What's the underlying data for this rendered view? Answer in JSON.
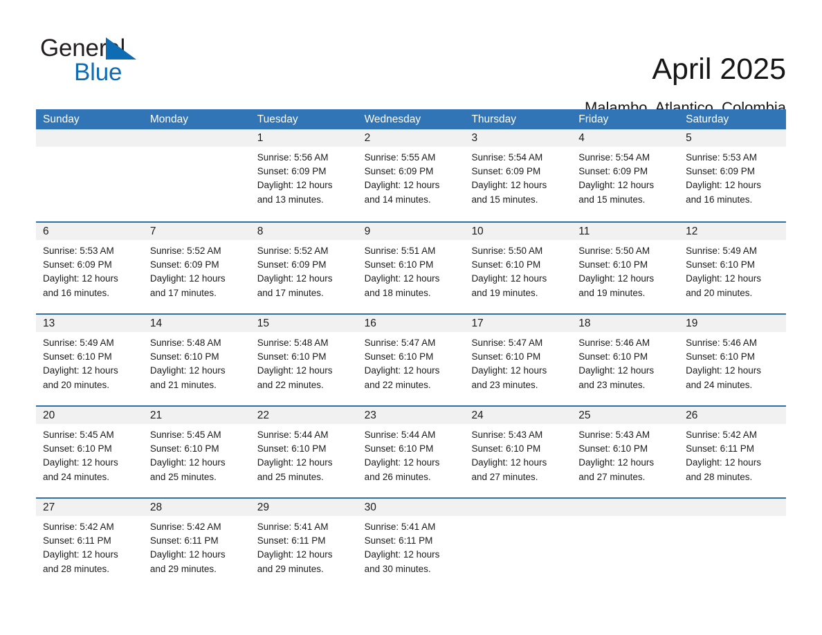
{
  "brand": {
    "name_part1": "General",
    "name_part2": "Blue",
    "triangle_color": "#0d6cb4",
    "text_color": "#231f20"
  },
  "header": {
    "title": "April 2025",
    "subtitle": "Malambo, Atlantico, Colombia"
  },
  "theme": {
    "header_blue": "#3175b7",
    "divider_blue": "#2f6fa8",
    "daynum_band": "#f1f1f1",
    "text": "#1a1a1a"
  },
  "weekdays": [
    "Sunday",
    "Monday",
    "Tuesday",
    "Wednesday",
    "Thursday",
    "Friday",
    "Saturday"
  ],
  "weeks": [
    [
      {
        "day": "",
        "lines": [
          "",
          "",
          "",
          ""
        ]
      },
      {
        "day": "",
        "lines": [
          "",
          "",
          "",
          ""
        ]
      },
      {
        "day": "1",
        "lines": [
          "Sunrise: 5:56 AM",
          "Sunset: 6:09 PM",
          "Daylight: 12 hours",
          "and 13 minutes."
        ]
      },
      {
        "day": "2",
        "lines": [
          "Sunrise: 5:55 AM",
          "Sunset: 6:09 PM",
          "Daylight: 12 hours",
          "and 14 minutes."
        ]
      },
      {
        "day": "3",
        "lines": [
          "Sunrise: 5:54 AM",
          "Sunset: 6:09 PM",
          "Daylight: 12 hours",
          "and 15 minutes."
        ]
      },
      {
        "day": "4",
        "lines": [
          "Sunrise: 5:54 AM",
          "Sunset: 6:09 PM",
          "Daylight: 12 hours",
          "and 15 minutes."
        ]
      },
      {
        "day": "5",
        "lines": [
          "Sunrise: 5:53 AM",
          "Sunset: 6:09 PM",
          "Daylight: 12 hours",
          "and 16 minutes."
        ]
      }
    ],
    [
      {
        "day": "6",
        "lines": [
          "Sunrise: 5:53 AM",
          "Sunset: 6:09 PM",
          "Daylight: 12 hours",
          "and 16 minutes."
        ]
      },
      {
        "day": "7",
        "lines": [
          "Sunrise: 5:52 AM",
          "Sunset: 6:09 PM",
          "Daylight: 12 hours",
          "and 17 minutes."
        ]
      },
      {
        "day": "8",
        "lines": [
          "Sunrise: 5:52 AM",
          "Sunset: 6:09 PM",
          "Daylight: 12 hours",
          "and 17 minutes."
        ]
      },
      {
        "day": "9",
        "lines": [
          "Sunrise: 5:51 AM",
          "Sunset: 6:10 PM",
          "Daylight: 12 hours",
          "and 18 minutes."
        ]
      },
      {
        "day": "10",
        "lines": [
          "Sunrise: 5:50 AM",
          "Sunset: 6:10 PM",
          "Daylight: 12 hours",
          "and 19 minutes."
        ]
      },
      {
        "day": "11",
        "lines": [
          "Sunrise: 5:50 AM",
          "Sunset: 6:10 PM",
          "Daylight: 12 hours",
          "and 19 minutes."
        ]
      },
      {
        "day": "12",
        "lines": [
          "Sunrise: 5:49 AM",
          "Sunset: 6:10 PM",
          "Daylight: 12 hours",
          "and 20 minutes."
        ]
      }
    ],
    [
      {
        "day": "13",
        "lines": [
          "Sunrise: 5:49 AM",
          "Sunset: 6:10 PM",
          "Daylight: 12 hours",
          "and 20 minutes."
        ]
      },
      {
        "day": "14",
        "lines": [
          "Sunrise: 5:48 AM",
          "Sunset: 6:10 PM",
          "Daylight: 12 hours",
          "and 21 minutes."
        ]
      },
      {
        "day": "15",
        "lines": [
          "Sunrise: 5:48 AM",
          "Sunset: 6:10 PM",
          "Daylight: 12 hours",
          "and 22 minutes."
        ]
      },
      {
        "day": "16",
        "lines": [
          "Sunrise: 5:47 AM",
          "Sunset: 6:10 PM",
          "Daylight: 12 hours",
          "and 22 minutes."
        ]
      },
      {
        "day": "17",
        "lines": [
          "Sunrise: 5:47 AM",
          "Sunset: 6:10 PM",
          "Daylight: 12 hours",
          "and 23 minutes."
        ]
      },
      {
        "day": "18",
        "lines": [
          "Sunrise: 5:46 AM",
          "Sunset: 6:10 PM",
          "Daylight: 12 hours",
          "and 23 minutes."
        ]
      },
      {
        "day": "19",
        "lines": [
          "Sunrise: 5:46 AM",
          "Sunset: 6:10 PM",
          "Daylight: 12 hours",
          "and 24 minutes."
        ]
      }
    ],
    [
      {
        "day": "20",
        "lines": [
          "Sunrise: 5:45 AM",
          "Sunset: 6:10 PM",
          "Daylight: 12 hours",
          "and 24 minutes."
        ]
      },
      {
        "day": "21",
        "lines": [
          "Sunrise: 5:45 AM",
          "Sunset: 6:10 PM",
          "Daylight: 12 hours",
          "and 25 minutes."
        ]
      },
      {
        "day": "22",
        "lines": [
          "Sunrise: 5:44 AM",
          "Sunset: 6:10 PM",
          "Daylight: 12 hours",
          "and 25 minutes."
        ]
      },
      {
        "day": "23",
        "lines": [
          "Sunrise: 5:44 AM",
          "Sunset: 6:10 PM",
          "Daylight: 12 hours",
          "and 26 minutes."
        ]
      },
      {
        "day": "24",
        "lines": [
          "Sunrise: 5:43 AM",
          "Sunset: 6:10 PM",
          "Daylight: 12 hours",
          "and 27 minutes."
        ]
      },
      {
        "day": "25",
        "lines": [
          "Sunrise: 5:43 AM",
          "Sunset: 6:10 PM",
          "Daylight: 12 hours",
          "and 27 minutes."
        ]
      },
      {
        "day": "26",
        "lines": [
          "Sunrise: 5:42 AM",
          "Sunset: 6:11 PM",
          "Daylight: 12 hours",
          "and 28 minutes."
        ]
      }
    ],
    [
      {
        "day": "27",
        "lines": [
          "Sunrise: 5:42 AM",
          "Sunset: 6:11 PM",
          "Daylight: 12 hours",
          "and 28 minutes."
        ]
      },
      {
        "day": "28",
        "lines": [
          "Sunrise: 5:42 AM",
          "Sunset: 6:11 PM",
          "Daylight: 12 hours",
          "and 29 minutes."
        ]
      },
      {
        "day": "29",
        "lines": [
          "Sunrise: 5:41 AM",
          "Sunset: 6:11 PM",
          "Daylight: 12 hours",
          "and 29 minutes."
        ]
      },
      {
        "day": "30",
        "lines": [
          "Sunrise: 5:41 AM",
          "Sunset: 6:11 PM",
          "Daylight: 12 hours",
          "and 30 minutes."
        ]
      },
      {
        "day": "",
        "lines": [
          "",
          "",
          "",
          ""
        ]
      },
      {
        "day": "",
        "lines": [
          "",
          "",
          "",
          ""
        ]
      },
      {
        "day": "",
        "lines": [
          "",
          "",
          "",
          ""
        ]
      }
    ]
  ]
}
